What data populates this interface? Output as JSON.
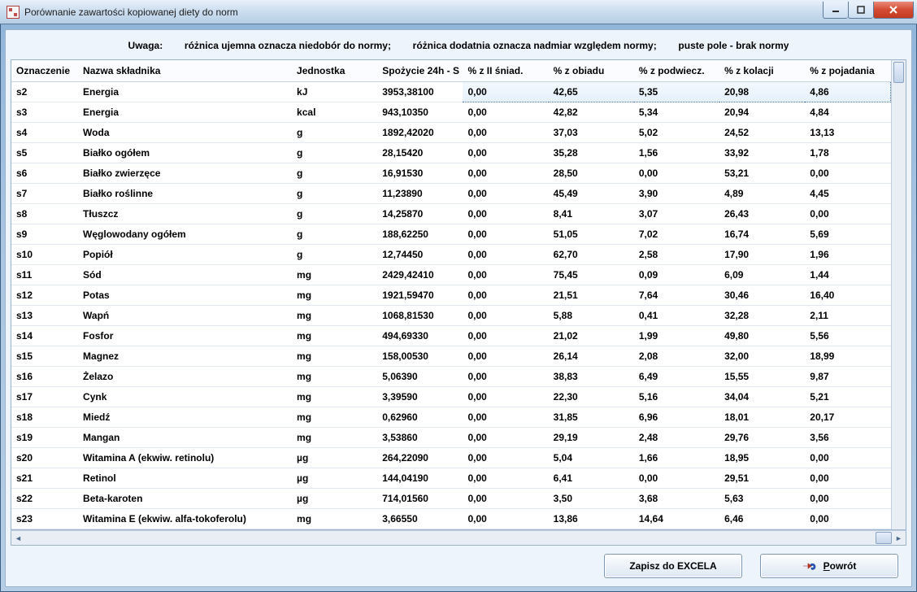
{
  "window": {
    "title": "Porównanie zawartości kopiowanej diety  do norm"
  },
  "warning": {
    "label": "Uwaga:",
    "part1": "różnica ujemna oznacza niedobór do normy;",
    "part2": "różnica dodatnia oznacza nadmiar względem normy;",
    "part3": "puste pole - brak normy"
  },
  "columns": {
    "c0": "Oznaczenie",
    "c1": "Nazwa składnika",
    "c2": "Jednostka",
    "c3": "Spożycie 24h - S",
    "c4": "% z II śniad.",
    "c5": "% z obiadu",
    "c6": "% z podwiecz.",
    "c7": "% z kolacji",
    "c8": "% z pojadania"
  },
  "rows": [
    {
      "id": "s2",
      "name": "Energia",
      "unit": "kJ",
      "intake": "3953,38100",
      "p1": "0,00",
      "p2": "42,65",
      "p3": "5,35",
      "p4": "20,98",
      "p5": "4,86"
    },
    {
      "id": "s3",
      "name": "Energia",
      "unit": "kcal",
      "intake": "943,10350",
      "p1": "0,00",
      "p2": "42,82",
      "p3": "5,34",
      "p4": "20,94",
      "p5": "4,84"
    },
    {
      "id": "s4",
      "name": "Woda",
      "unit": "g",
      "intake": "1892,42020",
      "p1": "0,00",
      "p2": "37,03",
      "p3": "5,02",
      "p4": "24,52",
      "p5": "13,13"
    },
    {
      "id": "s5",
      "name": "Białko ogółem",
      "unit": "g",
      "intake": "28,15420",
      "p1": "0,00",
      "p2": "35,28",
      "p3": "1,56",
      "p4": "33,92",
      "p5": "1,78"
    },
    {
      "id": "s6",
      "name": "Białko zwierzęce",
      "unit": "g",
      "intake": "16,91530",
      "p1": "0,00",
      "p2": "28,50",
      "p3": "0,00",
      "p4": "53,21",
      "p5": "0,00"
    },
    {
      "id": "s7",
      "name": "Białko roślinne",
      "unit": "g",
      "intake": "11,23890",
      "p1": "0,00",
      "p2": "45,49",
      "p3": "3,90",
      "p4": "4,89",
      "p5": "4,45"
    },
    {
      "id": "s8",
      "name": "Tłuszcz",
      "unit": "g",
      "intake": "14,25870",
      "p1": "0,00",
      "p2": "8,41",
      "p3": "3,07",
      "p4": "26,43",
      "p5": "0,00"
    },
    {
      "id": "s9",
      "name": "Węglowodany ogółem",
      "unit": "g",
      "intake": "188,62250",
      "p1": "0,00",
      "p2": "51,05",
      "p3": "7,02",
      "p4": "16,74",
      "p5": "5,69"
    },
    {
      "id": "s10",
      "name": "Popiół",
      "unit": "g",
      "intake": "12,74450",
      "p1": "0,00",
      "p2": "62,70",
      "p3": "2,58",
      "p4": "17,90",
      "p5": "1,96"
    },
    {
      "id": "s11",
      "name": "Sód",
      "unit": "mg",
      "intake": "2429,42410",
      "p1": "0,00",
      "p2": "75,45",
      "p3": "0,09",
      "p4": "6,09",
      "p5": "1,44"
    },
    {
      "id": "s12",
      "name": "Potas",
      "unit": "mg",
      "intake": "1921,59470",
      "p1": "0,00",
      "p2": "21,51",
      "p3": "7,64",
      "p4": "30,46",
      "p5": "16,40"
    },
    {
      "id": "s13",
      "name": "Wapń",
      "unit": "mg",
      "intake": "1068,81530",
      "p1": "0,00",
      "p2": "5,88",
      "p3": "0,41",
      "p4": "32,28",
      "p5": "2,11"
    },
    {
      "id": "s14",
      "name": "Fosfor",
      "unit": "mg",
      "intake": "494,69330",
      "p1": "0,00",
      "p2": "21,02",
      "p3": "1,99",
      "p4": "49,80",
      "p5": "5,56"
    },
    {
      "id": "s15",
      "name": "Magnez",
      "unit": "mg",
      "intake": "158,00530",
      "p1": "0,00",
      "p2": "26,14",
      "p3": "2,08",
      "p4": "32,00",
      "p5": "18,99"
    },
    {
      "id": "s16",
      "name": "Żelazo",
      "unit": "mg",
      "intake": "5,06390",
      "p1": "0,00",
      "p2": "38,83",
      "p3": "6,49",
      "p4": "15,55",
      "p5": "9,87"
    },
    {
      "id": "s17",
      "name": "Cynk",
      "unit": "mg",
      "intake": "3,39590",
      "p1": "0,00",
      "p2": "22,30",
      "p3": "5,16",
      "p4": "34,04",
      "p5": "5,21"
    },
    {
      "id": "s18",
      "name": "Miedź",
      "unit": "mg",
      "intake": "0,62960",
      "p1": "0,00",
      "p2": "31,85",
      "p3": "6,96",
      "p4": "18,01",
      "p5": "20,17"
    },
    {
      "id": "s19",
      "name": "Mangan",
      "unit": "mg",
      "intake": "3,53860",
      "p1": "0,00",
      "p2": "29,19",
      "p3": "2,48",
      "p4": "29,76",
      "p5": "3,56"
    },
    {
      "id": "s20",
      "name": "Witamina A (ekwiw. retinolu)",
      "unit": "µg",
      "intake": "264,22090",
      "p1": "0,00",
      "p2": "5,04",
      "p3": "1,66",
      "p4": "18,95",
      "p5": "0,00"
    },
    {
      "id": "s21",
      "name": "Retinol",
      "unit": "µg",
      "intake": "144,04190",
      "p1": "0,00",
      "p2": "6,41",
      "p3": "0,00",
      "p4": "29,51",
      "p5": "0,00"
    },
    {
      "id": "s22",
      "name": "Beta-karoten",
      "unit": "µg",
      "intake": "714,01560",
      "p1": "0,00",
      "p2": "3,50",
      "p3": "3,68",
      "p4": "5,63",
      "p5": "0,00"
    },
    {
      "id": "s23",
      "name": "Witamina E (ekwiw. alfa-tokoferolu)",
      "unit": "mg",
      "intake": "3,66550",
      "p1": "0,00",
      "p2": "13,86",
      "p3": "14,64",
      "p4": "6,46",
      "p5": "0,00"
    }
  ],
  "buttons": {
    "excel": "Zapisz do EXCELA",
    "back_prefix": "P",
    "back_rest": "owrót"
  }
}
